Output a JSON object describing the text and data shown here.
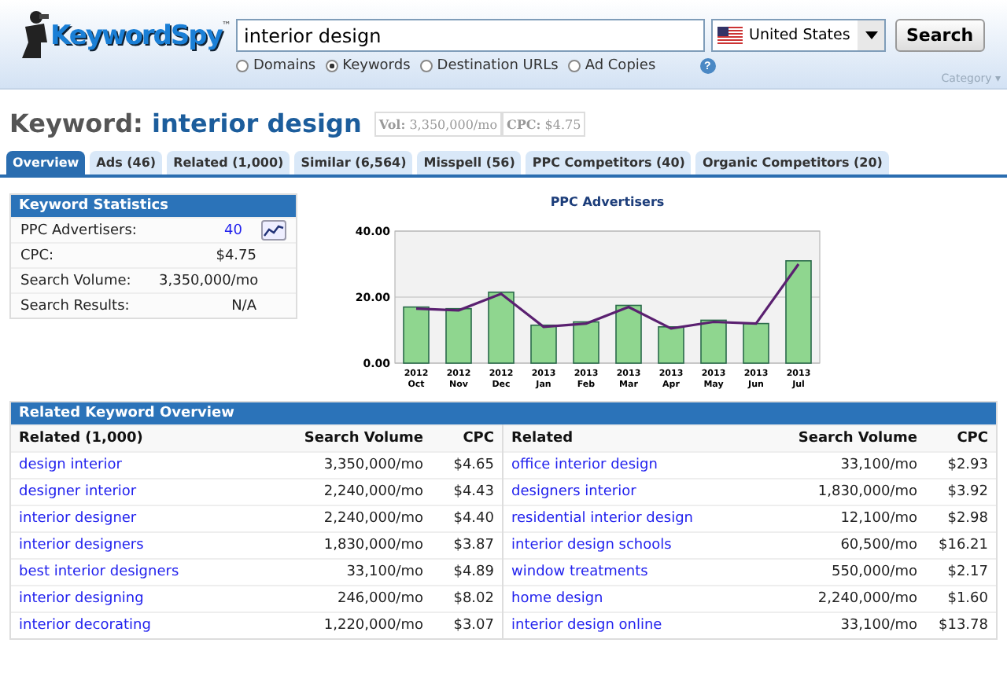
{
  "header": {
    "logo": "KeywordSpy",
    "logo_mark": "™",
    "search": {
      "value": "interior design"
    },
    "country": {
      "value": "United States"
    },
    "search_button": "Search",
    "modes": [
      {
        "label": "Domains",
        "selected": false
      },
      {
        "label": "Keywords",
        "selected": true
      },
      {
        "label": "Destination URLs",
        "selected": false
      },
      {
        "label": "Ad Copies",
        "selected": false
      }
    ],
    "help": "?",
    "category": "Category ▾"
  },
  "keyword": {
    "prefix": "Keyword:",
    "term": "interior design",
    "vol_label": "Vol:",
    "vol": "3,350,000/mo",
    "cpc_label": "CPC:",
    "cpc": "$4.75"
  },
  "tabs": [
    {
      "label": "Overview",
      "selected": true
    },
    {
      "label": "Ads (46)",
      "selected": false
    },
    {
      "label": "Related (1,000)",
      "selected": false
    },
    {
      "label": "Similar (6,564)",
      "selected": false
    },
    {
      "label": "Misspell (56)",
      "selected": false
    },
    {
      "label": "PPC Competitors (40)",
      "selected": false
    },
    {
      "label": "Organic Competitors (20)",
      "selected": false
    }
  ],
  "stats": {
    "title": "Keyword Statistics",
    "rows": [
      {
        "label": "PPC Advertisers:",
        "value": "40",
        "kind": "link"
      },
      {
        "label": "CPC:",
        "value": "$4.75",
        "kind": "plain"
      },
      {
        "label": "Search Volume:",
        "value": "3,350,000/mo",
        "kind": "plain"
      },
      {
        "label": "Search Results:",
        "value": "N/A",
        "kind": "plain"
      }
    ]
  },
  "chart": {
    "chart_data": {
      "type": "bar",
      "title": "PPC Advertisers",
      "categories": [
        "2012 Oct",
        "2012 Nov",
        "2012 Dec",
        "2013 Jan",
        "2013 Feb",
        "2013 Mar",
        "2013 Apr",
        "2013 May",
        "2013 Jun",
        "2013 Jul"
      ],
      "series": [
        {
          "type": "bar",
          "color": "#8fd68f",
          "values": [
            17,
            16.5,
            21.5,
            11.5,
            12.5,
            17.5,
            11,
            13,
            12,
            31
          ]
        },
        {
          "type": "line",
          "color": "#5a2070",
          "values": [
            16.5,
            16,
            21,
            11,
            12,
            17,
            10.5,
            12.5,
            12,
            30
          ]
        }
      ],
      "ylim": [
        0,
        40
      ],
      "yticks": [
        {
          "value": 0,
          "label": "0.00"
        },
        {
          "value": 20,
          "label": "20.00"
        },
        {
          "value": 40,
          "label": "40.00"
        }
      ]
    }
  },
  "related": {
    "title": "Related Keyword Overview",
    "columns": [
      {
        "name": "Related (1,000)",
        "volume": "Search Volume",
        "cpc": "CPC"
      },
      {
        "name": "Related",
        "volume": "Search Volume",
        "cpc": "CPC"
      }
    ],
    "rows": [
      [
        {
          "keyword": "design interior",
          "volume": "3,350,000/mo",
          "cpc": "$4.65"
        },
        {
          "keyword": "office interior design",
          "volume": "33,100/mo",
          "cpc": "$2.93"
        }
      ],
      [
        {
          "keyword": "designer interior",
          "volume": "2,240,000/mo",
          "cpc": "$4.43"
        },
        {
          "keyword": "designers interior",
          "volume": "1,830,000/mo",
          "cpc": "$3.92"
        }
      ],
      [
        {
          "keyword": "interior designer",
          "volume": "2,240,000/mo",
          "cpc": "$4.40"
        },
        {
          "keyword": "residential interior design",
          "volume": "12,100/mo",
          "cpc": "$2.98"
        }
      ],
      [
        {
          "keyword": "interior designers",
          "volume": "1,830,000/mo",
          "cpc": "$3.87"
        },
        {
          "keyword": "interior design schools",
          "volume": "60,500/mo",
          "cpc": "$16.21"
        }
      ],
      [
        {
          "keyword": "best interior designers",
          "volume": "33,100/mo",
          "cpc": "$4.89"
        },
        {
          "keyword": "window treatments",
          "volume": "550,000/mo",
          "cpc": "$2.17"
        }
      ],
      [
        {
          "keyword": "interior designing",
          "volume": "246,000/mo",
          "cpc": "$8.02"
        },
        {
          "keyword": "home design",
          "volume": "2,240,000/mo",
          "cpc": "$1.60"
        }
      ],
      [
        {
          "keyword": "interior decorating",
          "volume": "1,220,000/mo",
          "cpc": "$3.07"
        },
        {
          "keyword": "interior design online",
          "volume": "33,100/mo",
          "cpc": "$13.78"
        }
      ]
    ]
  }
}
